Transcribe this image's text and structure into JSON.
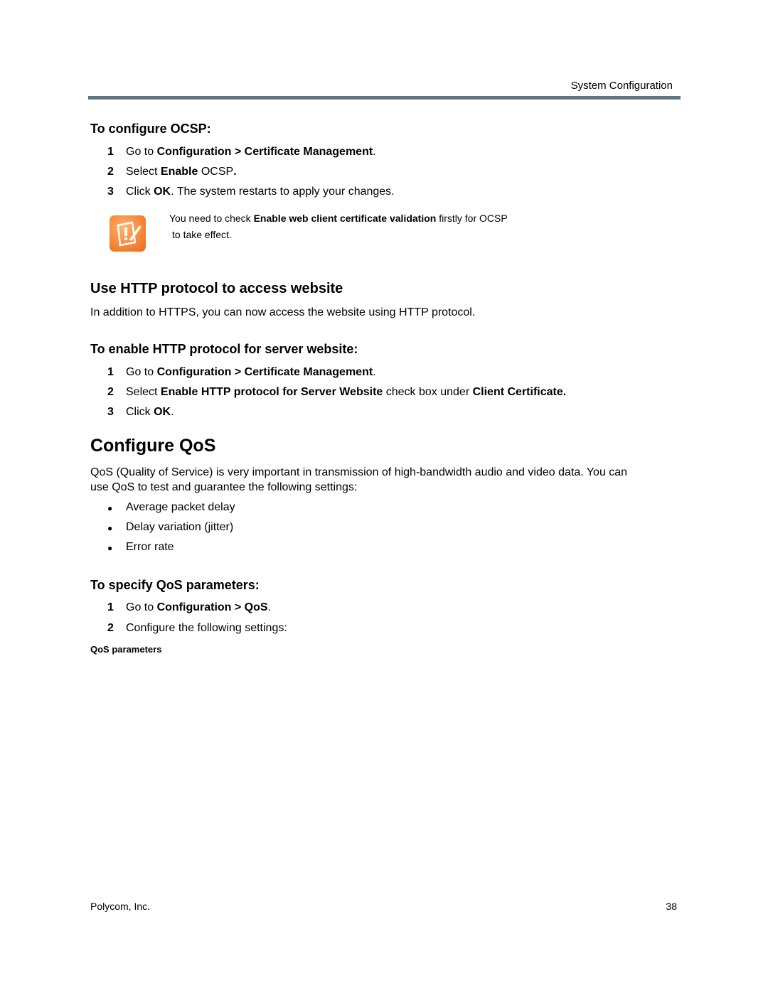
{
  "header": {
    "title": "System Configuration"
  },
  "ocsp": {
    "heading": "To configure OCSP:",
    "steps": [
      {
        "num": "1",
        "pre": "Go to ",
        "bold": "Configuration > Certificate Management",
        "post": "."
      },
      {
        "num": "2",
        "pre": "Select ",
        "bold": "Enable",
        "post": " OCSP",
        "bold2": "."
      },
      {
        "num": "3",
        "pre": "Click ",
        "bold": "OK",
        "post": ". The system restarts to apply your changes."
      }
    ],
    "note": {
      "icon": "note-warning-icon",
      "pre": "You need to check ",
      "bold": "Enable web client certificate validation",
      "post": " firstly for OCSP",
      "line2": " to take effect."
    }
  },
  "http": {
    "heading": "Use HTTP protocol to access website",
    "intro": "In addition to HTTPS, you can now access the website using HTTP protocol.",
    "subheading": "To enable HTTP protocol for server website:",
    "steps": [
      {
        "num": "1",
        "pre": "Go to ",
        "bold": "Configuration > Certificate Management",
        "post": "."
      },
      {
        "num": "2",
        "pre": "Select ",
        "bold": "Enable HTTP protocol for Server Website",
        "post": " check box under ",
        "bold2": "Client Certificate."
      },
      {
        "num": "3",
        "pre": "Click ",
        "bold": "OK",
        "post": "."
      }
    ]
  },
  "qos": {
    "heading": "Configure QoS",
    "intro_line1": "QoS (Quality of Service) is very important in transmission of high-bandwidth audio and video data. You can",
    "intro_line2": "use QoS to test and guarantee the following settings:",
    "bullets": [
      "Average packet delay",
      "Delay variation (jitter)",
      "Error rate"
    ],
    "subheading": "To specify QoS parameters:",
    "steps": [
      {
        "num": "1",
        "pre": "Go to ",
        "bold": "Configuration > QoS",
        "post": "."
      },
      {
        "num": "2",
        "pre": "Configure the following settings:",
        "bold": "",
        "post": ""
      }
    ],
    "table_caption": "QoS parameters"
  },
  "footer": {
    "company": "Polycom, Inc.",
    "page_number": "38"
  }
}
